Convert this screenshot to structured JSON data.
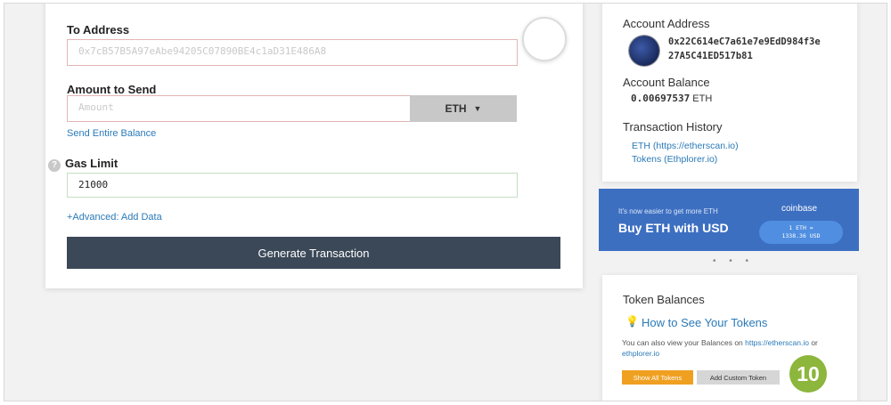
{
  "send_form": {
    "to_address_label": "To Address",
    "to_address_value": "0x7cB57B5A97eAbe94205C07890BE4c1aD31E486A8",
    "amount_label": "Amount to Send",
    "amount_placeholder": "Amount",
    "currency": "ETH",
    "send_entire_balance": "Send Entire Balance",
    "gas_limit_label": "Gas Limit",
    "gas_limit_value": "21000",
    "advanced_link": "+Advanced: Add Data",
    "generate_button": "Generate Transaction",
    "help_glyph": "?"
  },
  "account": {
    "address_label": "Account Address",
    "address_line1": "0x22C614eC7a61e7e9EdD984f3e",
    "address_line2": "27A5C41ED517b81",
    "balance_label": "Account Balance",
    "balance_value": "0.00697537",
    "balance_unit": "ETH",
    "history_label": "Transaction History",
    "history_links": [
      "ETH (https://etherscan.io)",
      "Tokens (Ethplorer.io)"
    ]
  },
  "promo": {
    "small_text": "It's now easier to get more ETH",
    "big_text": "Buy ETH with USD",
    "brand": "coinbase",
    "rate_line1": "1 ETH =",
    "rate_line2": "1338.36 USD",
    "dots": "• • •"
  },
  "tokens": {
    "heading": "Token Balances",
    "how_link": "How to See Your Tokens",
    "desc_prefix": "You can also view your Balances on ",
    "desc_link1": "https://etherscan.io",
    "desc_mid": " or ",
    "desc_link2": "ethplorer.io",
    "show_all_button": "Show All Tokens",
    "add_custom_button": "Add Custom Token"
  },
  "step_badge": "10",
  "colors": {
    "primary_button": "#3b4858",
    "link": "#2a7ab8",
    "promo_bg": "#3d6fc1",
    "orange_button": "#f0a021",
    "step_badge": "#8cb63c"
  }
}
